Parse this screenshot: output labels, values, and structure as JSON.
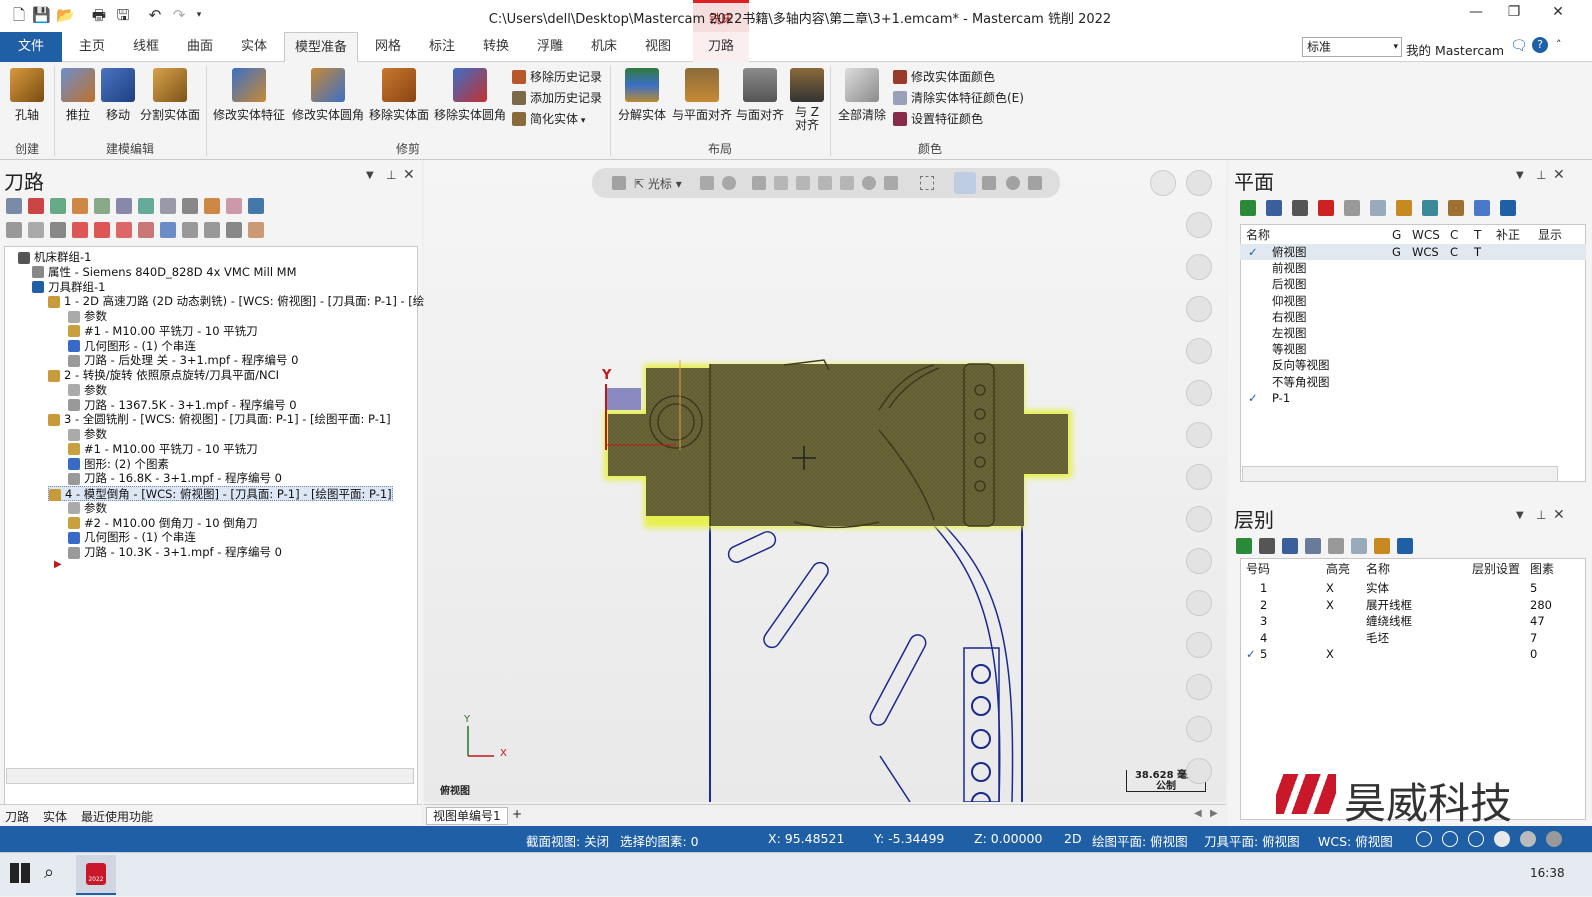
{
  "window": {
    "title": "C:\\Users\\dell\\Desktop\\Mastercam 2022书籍\\多轴内容\\第二章\\3+1.emcam* - Mastercam 铣削 2022",
    "context_tab": "铣床"
  },
  "tabs": [
    "文件",
    "主页",
    "线框",
    "曲面",
    "实体",
    "模型准备",
    "网格",
    "标注",
    "转换",
    "浮雕",
    "机床",
    "视图",
    "刀路"
  ],
  "active_tab": "模型准备",
  "right_header": {
    "dropdown_value": "标准",
    "my_mastercam": "我的 Mastercam"
  },
  "ribbon": {
    "buttons": {
      "hole_axis": "孔轴",
      "push_pull": "推拉",
      "move": "移动",
      "split_solid": "分割实体面",
      "modify_feature": "修改实体特征",
      "modify_fillet": "修改实体圆角",
      "remove_solid_face": "移除实体面",
      "remove_solid_fillet": "移除实体圆角",
      "decompose": "分解实体",
      "align_plane": "与平面对齐",
      "align_face": "与面对齐",
      "align_z": "与 Z 对齐",
      "clear_all": "全部清除"
    },
    "small": {
      "remove_history": "移除历史记录",
      "add_history": "添加历史记录",
      "simplify": "简化实体",
      "modify_face_color": "修改实体面颜色",
      "clear_feature_color": "清除实体特征颜色(E)",
      "set_feature_color": "设置特征颜色"
    },
    "groups": {
      "create": "创建",
      "model_edit": "建模编辑",
      "repair": "修剪",
      "layout": "布局",
      "color": "颜色"
    }
  },
  "toolpath_panel": {
    "title": "刀路",
    "tree": [
      "机床群组-1",
      "属性 - Siemens 840D_828D 4x VMC Mill MM",
      "刀具群组-1",
      "1 - 2D 高速刀路 (2D 动态剥铣) - [WCS: 俯视图] - [刀具面: P-1] - [绘",
      "参数",
      "#1 - M10.00 平铣刀 - 10 平铣刀",
      "几何图形 - (1) 个串连",
      "刀路 - 后处理 关 - 3+1.mpf - 程序编号 0",
      "2 - 转换/旋转 依照原点旋转/刀具平面/NCI",
      "参数",
      "刀路 - 1367.5K - 3+1.mpf - 程序编号 0",
      "3 - 全圆铣削 - [WCS: 俯视图] - [刀具面: P-1] - [绘图平面: P-1]",
      "参数",
      "#1 - M10.00 平铣刀 - 10 平铣刀",
      "图形: (2) 个图素",
      "刀路 - 16.8K - 3+1.mpf - 程序编号 0",
      "4 - 模型倒角 - [WCS: 俯视图] - [刀具面: P-1] - [绘图平面: P-1]",
      "参数",
      "#2 - M10.00 倒角刀 - 10 倒角刀",
      "几何图形 - (1) 个串连",
      "刀路 - 10.3K - 3+1.mpf - 程序编号 0"
    ],
    "bottom_tabs": [
      "刀路",
      "实体",
      "最近使用功能"
    ]
  },
  "viewport": {
    "toolbar_label": "光标",
    "view_name": "俯视图",
    "scale_value": "38.628 毫米",
    "scale_unit": "公制",
    "axis_y": "Y",
    "axis_x": "X",
    "tab_label": "视图单编号1",
    "add_tab": "+"
  },
  "plane_panel": {
    "title": "平面",
    "columns": [
      "名称",
      "G",
      "WCS",
      "C",
      "T",
      "补正",
      "显示"
    ],
    "rows": [
      {
        "check": "✓",
        "name": "俯视图",
        "g": "G",
        "wcs": "WCS",
        "c": "C",
        "t": "T"
      },
      {
        "check": "",
        "name": "前视图",
        "g": "",
        "wcs": "",
        "c": "",
        "t": ""
      },
      {
        "check": "",
        "name": "后视图",
        "g": "",
        "wcs": "",
        "c": "",
        "t": ""
      },
      {
        "check": "",
        "name": "仰视图",
        "g": "",
        "wcs": "",
        "c": "",
        "t": ""
      },
      {
        "check": "",
        "name": "右视图",
        "g": "",
        "wcs": "",
        "c": "",
        "t": ""
      },
      {
        "check": "",
        "name": "左视图",
        "g": "",
        "wcs": "",
        "c": "",
        "t": ""
      },
      {
        "check": "",
        "name": "等视图",
        "g": "",
        "wcs": "",
        "c": "",
        "t": ""
      },
      {
        "check": "",
        "name": "反向等视图",
        "g": "",
        "wcs": "",
        "c": "",
        "t": ""
      },
      {
        "check": "",
        "name": "不等角视图",
        "g": "",
        "wcs": "",
        "c": "",
        "t": ""
      },
      {
        "check": "✓",
        "name": "P-1",
        "g": "",
        "wcs": "",
        "c": "",
        "t": ""
      }
    ]
  },
  "level_panel": {
    "title": "层别",
    "columns": [
      "号码",
      "高亮",
      "名称",
      "层别设置",
      "图素"
    ],
    "rows": [
      {
        "check": "",
        "num": "1",
        "hl": "X",
        "name": "实体",
        "count": "5"
      },
      {
        "check": "",
        "num": "2",
        "hl": "X",
        "name": "展开线框",
        "count": "280"
      },
      {
        "check": "",
        "num": "3",
        "hl": "",
        "name": "缠绕线框",
        "count": "47"
      },
      {
        "check": "",
        "num": "4",
        "hl": "",
        "name": "毛坯",
        "count": "7"
      },
      {
        "check": "✓",
        "num": "5",
        "hl": "X",
        "name": "",
        "count": "0"
      }
    ]
  },
  "watermark": "昊威科技",
  "status": {
    "section_view": "截面视图: 关闭",
    "selected": "选择的图素: 0",
    "x": "X:  95.48521",
    "y": "Y:  -5.34499",
    "z": "Z:  0.00000",
    "mode": "2D",
    "draw_plane": "绘图平面: 俯视图",
    "tool_plane": "刀具平面: 俯视图",
    "wcs": "WCS: 俯视图"
  },
  "taskbar": {
    "clock": "16:38",
    "app_badge": "2022"
  },
  "colors": {
    "accent": "#1f5fa6",
    "part": "#6b6637",
    "glow": "#e8f050",
    "wire": "#1b2a8c"
  }
}
